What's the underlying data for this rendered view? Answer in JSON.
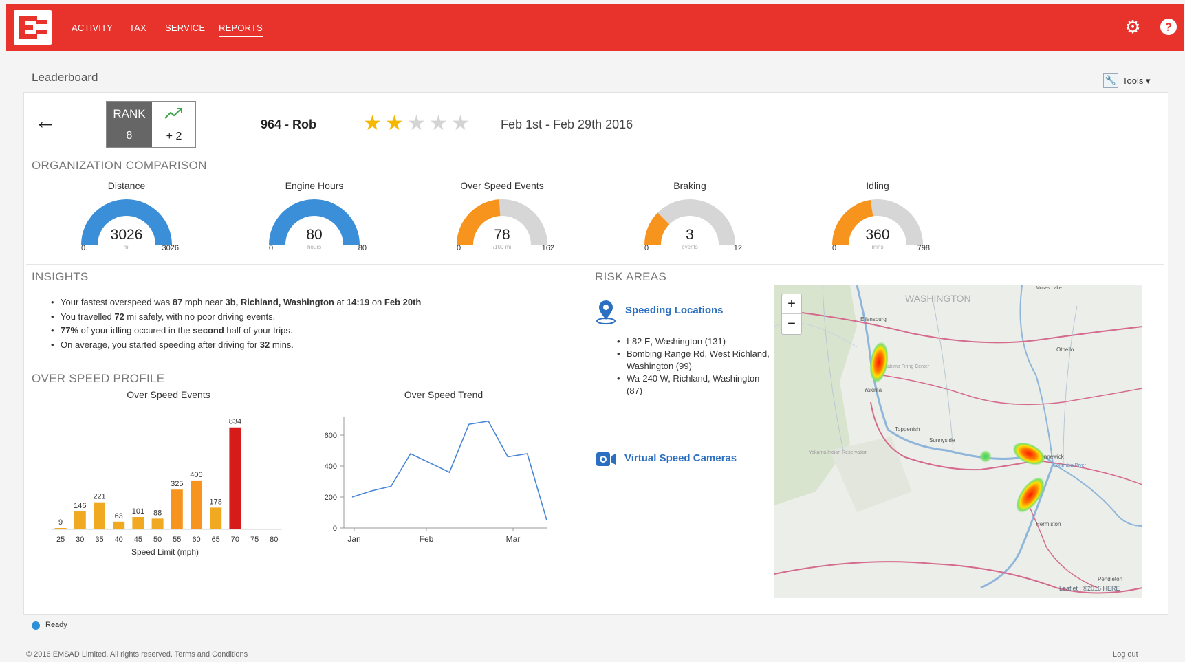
{
  "header": {
    "nav": [
      "ACTIVITY",
      "TAX",
      "SERVICE",
      "REPORTS"
    ],
    "active_tab": "REPORTS"
  },
  "page": {
    "title": "Leaderboard",
    "tools_label": "Tools ▾"
  },
  "driver_bar": {
    "rank_label": "RANK",
    "rank_value": "8",
    "rank_change": "+ 2",
    "driver": "964 - Rob",
    "stars_filled": 2,
    "stars_total": 5,
    "date_range": "Feb 1st - Feb 29th 2016"
  },
  "org_comparison": {
    "title": "ORGANIZATION COMPARISON",
    "gauges": [
      {
        "label": "Distance",
        "value": "3026",
        "unit": "mi",
        "min": "0",
        "max": "3026",
        "fraction": 1.0,
        "color": "#3a8fd8"
      },
      {
        "label": "Engine Hours",
        "value": "80",
        "unit": "hours",
        "min": "0",
        "max": "80",
        "fraction": 1.0,
        "color": "#3a8fd8"
      },
      {
        "label": "Over Speed Events",
        "value": "78",
        "unit": "/100 mi",
        "min": "0",
        "max": "162",
        "fraction": 0.48,
        "color": "#f7941d"
      },
      {
        "label": "Braking",
        "value": "3",
        "unit": "events",
        "min": "0",
        "max": "12",
        "fraction": 0.25,
        "color": "#f7941d"
      },
      {
        "label": "Idling",
        "value": "360",
        "unit": "mins",
        "min": "0",
        "max": "798",
        "fraction": 0.45,
        "color": "#f7941d"
      }
    ]
  },
  "insights": {
    "title": "INSIGHTS",
    "items": [
      [
        {
          "t": "Your fastest overspeed was "
        },
        {
          "t": "87",
          "b": true
        },
        {
          "t": " mph near "
        },
        {
          "t": "3b, Richland, Washington",
          "b": true
        },
        {
          "t": " at "
        },
        {
          "t": "14:19",
          "b": true
        },
        {
          "t": " on "
        },
        {
          "t": "Feb 20th",
          "b": true
        }
      ],
      [
        {
          "t": "You travelled "
        },
        {
          "t": "72",
          "b": true
        },
        {
          "t": " mi safely, with no poor driving events."
        }
      ],
      [
        {
          "t": "77%",
          "b": true
        },
        {
          "t": " of your idling occured in the "
        },
        {
          "t": "second",
          "b": true
        },
        {
          "t": " half of your trips."
        }
      ],
      [
        {
          "t": "On average, you started speeding after driving for "
        },
        {
          "t": "32",
          "b": true
        },
        {
          "t": " mins."
        }
      ]
    ]
  },
  "over_speed_profile": {
    "title": "OVER SPEED PROFILE"
  },
  "chart_data": [
    {
      "type": "bar",
      "title": "Over Speed Events",
      "xlabel": "Speed Limit (mph)",
      "ylabel": "",
      "categories": [
        "25",
        "30",
        "35",
        "40",
        "45",
        "50",
        "55",
        "60",
        "65",
        "70",
        "75",
        "80"
      ],
      "values": [
        9,
        146,
        221,
        63,
        101,
        88,
        325,
        400,
        178,
        834,
        null,
        null
      ],
      "colors": [
        "#f0a920",
        "#f0a920",
        "#f0a920",
        "#f0a920",
        "#f0a920",
        "#f0a920",
        "#f7941d",
        "#f7941d",
        "#f0a920",
        "#d71a1a",
        "#f0a920",
        "#f0a920"
      ],
      "ylim": [
        0,
        900
      ],
      "grid": false
    },
    {
      "type": "line",
      "title": "Over Speed Trend",
      "xlabel": "",
      "ylabel": "",
      "x_ticks": [
        "Jan",
        "Feb",
        "Mar"
      ],
      "y_ticks": [
        0,
        200,
        400,
        600
      ],
      "ylim": [
        0,
        720
      ],
      "series": [
        {
          "values": [
            200,
            240,
            270,
            480,
            420,
            360,
            670,
            690,
            460,
            480,
            50
          ],
          "color": "#4a86d6"
        }
      ],
      "grid": false
    }
  ],
  "risk": {
    "title": "RISK AREAS",
    "speeding_label": "Speeding Locations",
    "locations": [
      "I-82 E, Washington (131)",
      "Bombing Range Rd, West Richland, Washington (99)",
      "Wa-240 W, Richland, Washington (87)"
    ],
    "cameras_label": "Virtual Speed Cameras"
  },
  "map": {
    "zoom_in": "+",
    "zoom_out": "−",
    "labels": [
      "WASHINGTON",
      "Ellensburg",
      "Yakima",
      "Toppenish",
      "Sunnyside",
      "Kennewick",
      "Hermiston",
      "Pendleton",
      "Othello",
      "Yakama Indian Reservation",
      "Yakima Firing Center",
      "Moses Lake",
      "Columbia River"
    ],
    "attribution": "Leaflet | ©2016 HERE"
  },
  "status": {
    "text": "Ready"
  },
  "footer": {
    "copyright": "© 2016 EMSAD Limited. All rights reserved.   Terms and Conditions",
    "logout": "Log out"
  },
  "colors": {
    "brand": "#e8332c",
    "link": "#2b6fc2",
    "bar": "#f0a920",
    "bar_high": "#d71a1a",
    "gauge_blue": "#3a8fd8",
    "gauge_orange": "#f7941d"
  }
}
